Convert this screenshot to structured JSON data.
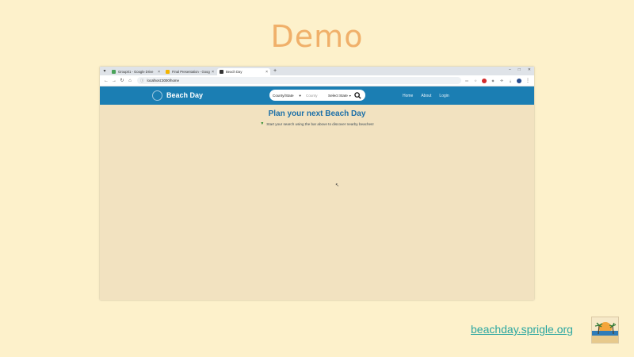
{
  "slide": {
    "title": "Demo",
    "footer_link": "beachday.sprigle.org",
    "badge_text": "BEACH DAY"
  },
  "browser": {
    "tabs": [
      {
        "title": "Group01 - Google Drive",
        "favicon_color": "#4aa35a",
        "active": false
      },
      {
        "title": "Final Presentation - Google Sli",
        "favicon_color": "#f4b400",
        "active": false
      },
      {
        "title": "Beach Day",
        "favicon_color": "#333333",
        "active": true
      }
    ],
    "url": "localhost:3000/home"
  },
  "app": {
    "brand": "Beach Day",
    "search": {
      "select_label": "County/State",
      "input_placeholder": "County",
      "state_select_label": "Select State"
    },
    "nav": [
      "Home",
      "About",
      "Login"
    ],
    "main_title": "Plan your next Beach Day",
    "hint": "Start your search using the bar above to discover nearby beaches!"
  },
  "colors": {
    "slide_bg": "#fdf1cb",
    "header_blue": "#1b7eb3",
    "title_blue": "#1b6fa8",
    "page_bg": "#f2e2c0",
    "link_teal": "#2aa6a0",
    "slide_title": "#f0b06a"
  },
  "icons": {
    "search": "search-icon",
    "hint": "pin-icon",
    "logo": "beach-ball-icon"
  }
}
